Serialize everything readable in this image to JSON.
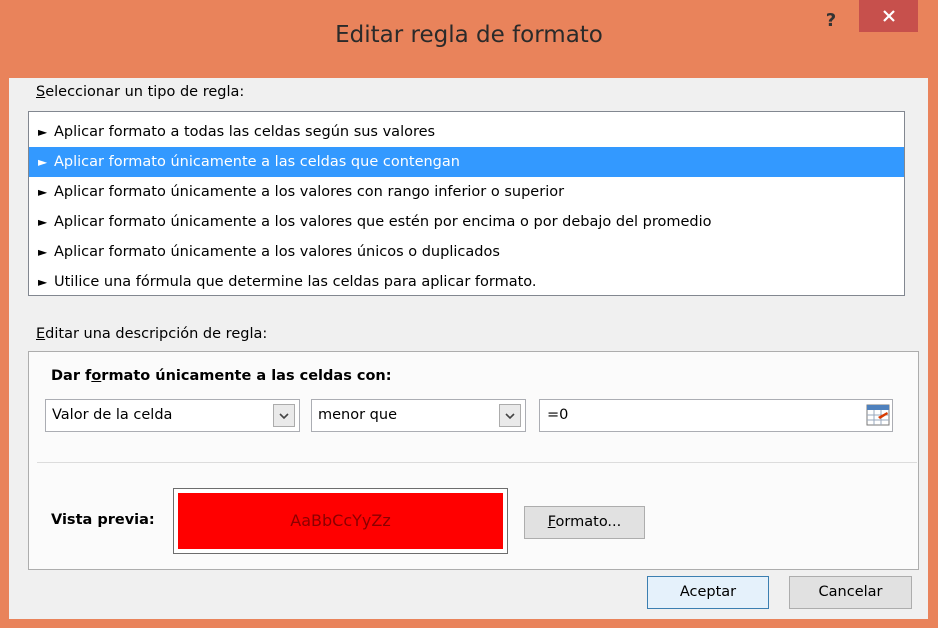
{
  "window": {
    "title": "Editar regla de formato",
    "help_symbol": "?",
    "close_label": "×"
  },
  "rule_type": {
    "label_accel": "S",
    "label_rest": "eleccionar un tipo de regla:",
    "arrow_symbol": "►",
    "items": [
      {
        "label": "Aplicar formato a todas las celdas según sus valores",
        "selected": false
      },
      {
        "label": "Aplicar formato únicamente a las celdas que contengan",
        "selected": true
      },
      {
        "label": "Aplicar formato únicamente a los valores con rango inferior o superior",
        "selected": false
      },
      {
        "label": "Aplicar formato únicamente a los valores que estén por encima o por debajo del promedio",
        "selected": false
      },
      {
        "label": "Aplicar formato únicamente a los valores únicos o duplicados",
        "selected": false
      },
      {
        "label": "Utilice una fórmula que determine las celdas para aplicar formato.",
        "selected": false
      }
    ]
  },
  "description": {
    "label_accel": "E",
    "label_rest": "ditar una descripción de regla:",
    "heading_pre": "Dar f",
    "heading_accel": "o",
    "heading_post": "rmato únicamente a las celdas con:",
    "condition_type": "Valor de la celda",
    "operator": "menor que",
    "value": "=0"
  },
  "preview": {
    "label": "Vista previa:",
    "sample_text": "AaBbCcYyZz",
    "fill_color": "#ff0000",
    "text_color": "#8b0000"
  },
  "buttons": {
    "format_accel": "F",
    "format_rest": "ormato...",
    "ok_label": "Aceptar",
    "cancel_label": "Cancelar"
  },
  "colors": {
    "frame": "#e9835b",
    "close_button": "#c7504c",
    "selection": "#3399ff"
  }
}
